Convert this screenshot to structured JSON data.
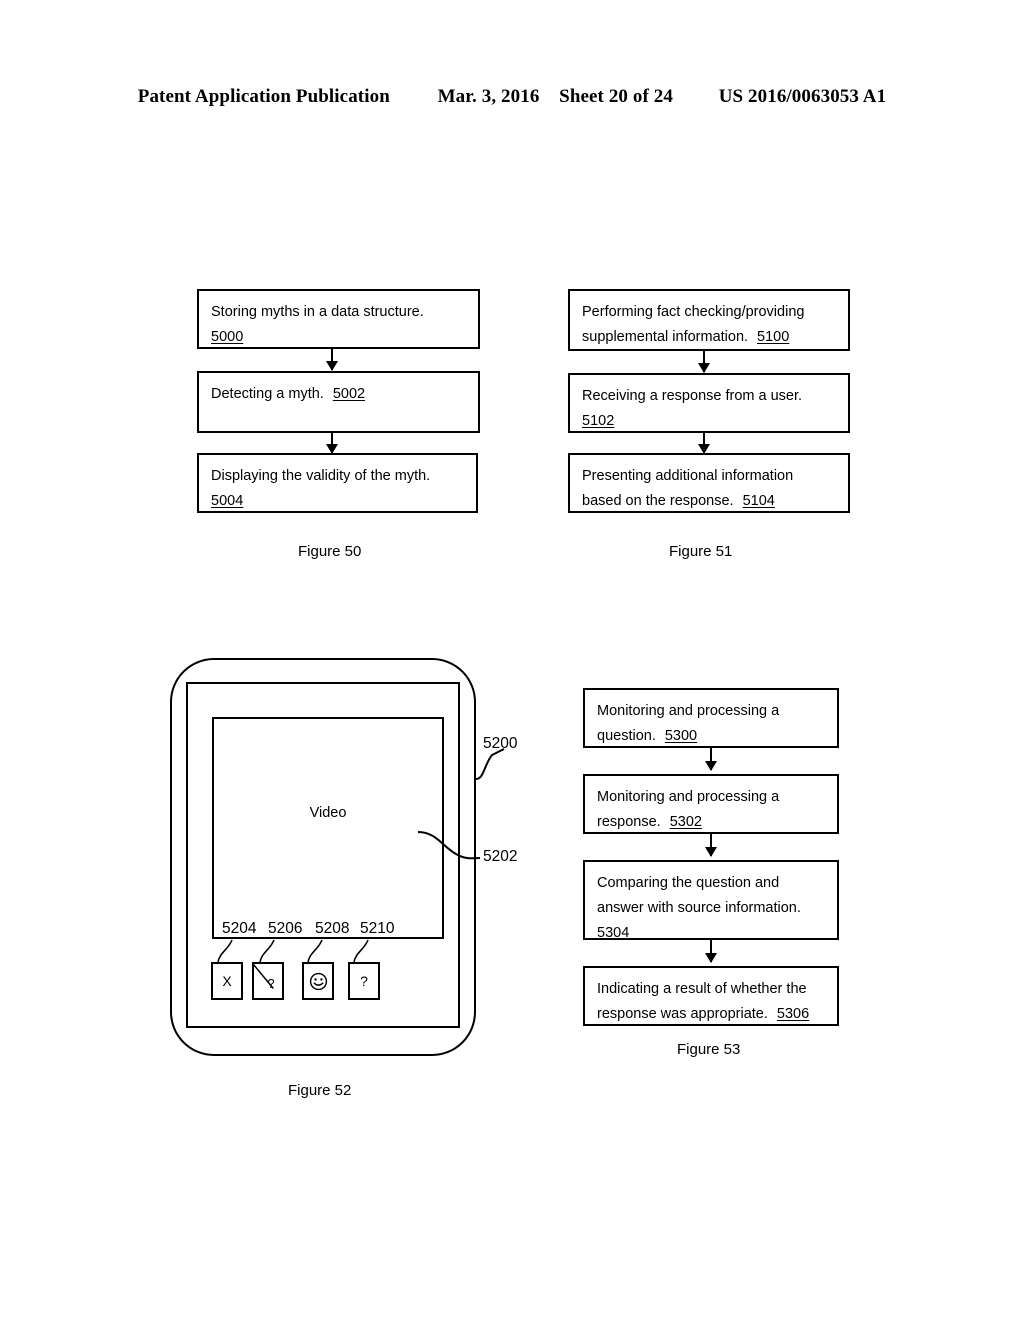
{
  "header": {
    "publication": "Patent Application Publication",
    "date": "Mar. 3, 2016",
    "sheet": "Sheet 20 of 24",
    "patent_number": "US 2016/0063053 A1"
  },
  "figure50": {
    "caption": "Figure 50",
    "steps": [
      {
        "lines": [
          "Storing myths in a data structure."
        ],
        "ref": "5000",
        "ref_on_new_line": true
      },
      {
        "lines": [
          "Detecting a myth."
        ],
        "ref": "5002",
        "ref_on_new_line": false
      },
      {
        "lines": [
          "Displaying the validity of the myth."
        ],
        "ref": "5004",
        "ref_on_new_line": true
      }
    ]
  },
  "figure51": {
    "caption": "Figure 51",
    "steps": [
      {
        "lines": [
          "Performing fact checking/providing",
          "supplemental information."
        ],
        "ref": "5100",
        "ref_on_new_line": false
      },
      {
        "lines": [
          "Receiving a response from a user."
        ],
        "ref": "5102",
        "ref_on_new_line": true
      },
      {
        "lines": [
          "Presenting additional information",
          "based on the response."
        ],
        "ref": "5104",
        "ref_on_new_line": false
      }
    ]
  },
  "figure52": {
    "caption": "Figure 52",
    "screen_label": "Video",
    "callouts": {
      "device": "5200",
      "screen": "5202",
      "button_x": "5204",
      "button_no_question": "5206",
      "button_smiley": "5208",
      "button_question": "5210"
    },
    "buttons": [
      {
        "name": "close-x-button",
        "glyph": "X"
      },
      {
        "name": "no-question-button",
        "glyph": "?"
      },
      {
        "name": "smiley-button",
        "glyph": "smiley-face-icon"
      },
      {
        "name": "question-button",
        "glyph": "?"
      }
    ]
  },
  "figure53": {
    "caption": "Figure 53",
    "steps": [
      {
        "lines": [
          "Monitoring and processing a",
          "question."
        ],
        "ref": "5300",
        "ref_on_new_line": false
      },
      {
        "lines": [
          "Monitoring and processing a",
          "response."
        ],
        "ref": "5302",
        "ref_on_new_line": false
      },
      {
        "lines": [
          "Comparing the question and",
          "answer with source information."
        ],
        "ref": "5304",
        "ref_on_new_line": true
      },
      {
        "lines": [
          "Indicating a result of whether the",
          "response was appropriate."
        ],
        "ref": "5306",
        "ref_on_new_line": false
      }
    ]
  },
  "colors": {
    "ink": "#000000",
    "paper": "#ffffff"
  }
}
